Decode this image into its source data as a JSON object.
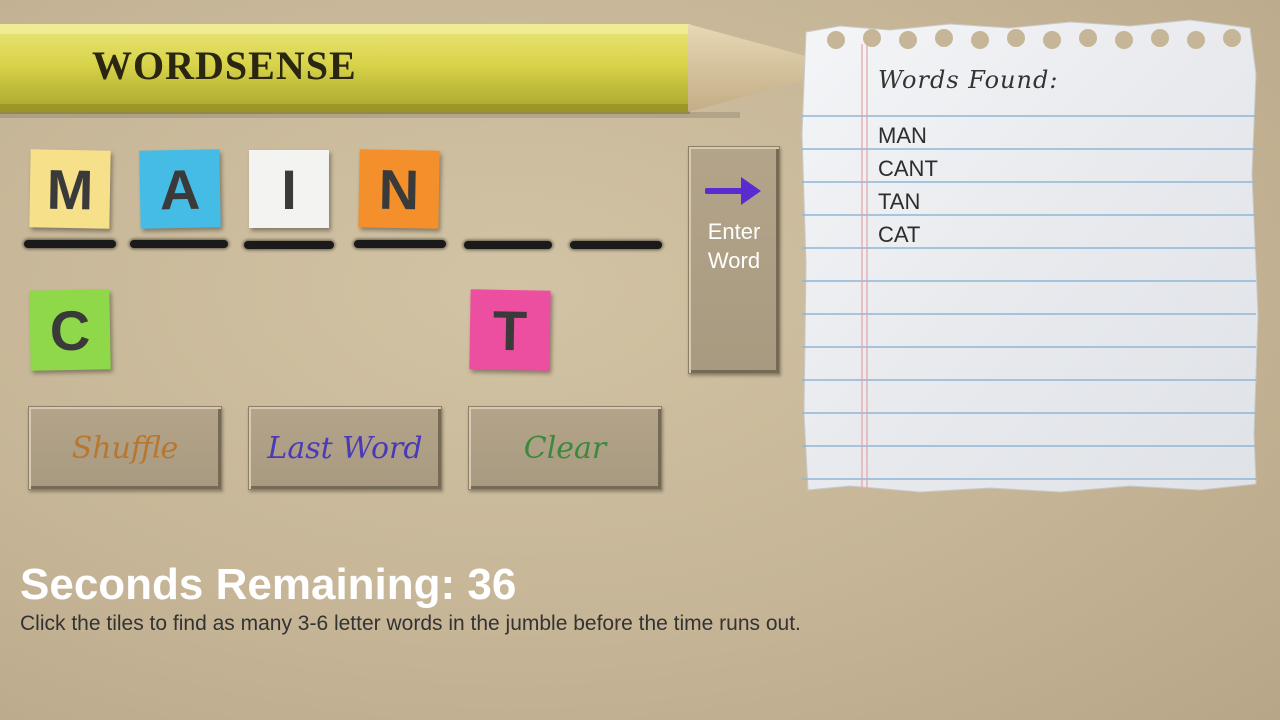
{
  "game": {
    "title": "WORDSENSE"
  },
  "tiles": {
    "selected": [
      {
        "letter": "M",
        "color": "#f6e18a"
      },
      {
        "letter": "A",
        "color": "#45bce6"
      },
      {
        "letter": "I",
        "color": "#f3f3f1"
      },
      {
        "letter": "N",
        "color": "#f4902c"
      }
    ],
    "available": [
      {
        "letter": "C",
        "color": "#8fd84a"
      },
      {
        "letter": "T",
        "color": "#ec4ea0"
      }
    ]
  },
  "buttons": {
    "enter_line1": "Enter",
    "enter_line2": "Word",
    "shuffle": "Shuffle",
    "shuffle_color": "#b8772e",
    "last_word": "Last Word",
    "last_word_color": "#4a3ab8",
    "clear": "Clear",
    "clear_color": "#3b8a3b",
    "arrow_color": "#5b2ad0"
  },
  "words_found": {
    "title": "Words Found:",
    "words": [
      "MAN",
      "CANT",
      "TAN",
      "CAT"
    ]
  },
  "status": {
    "seconds_label": "Seconds Remaining:",
    "seconds_value": "36",
    "instructions": "Click the tiles to find as many 3-6 letter words in the jumble before the time runs out."
  }
}
